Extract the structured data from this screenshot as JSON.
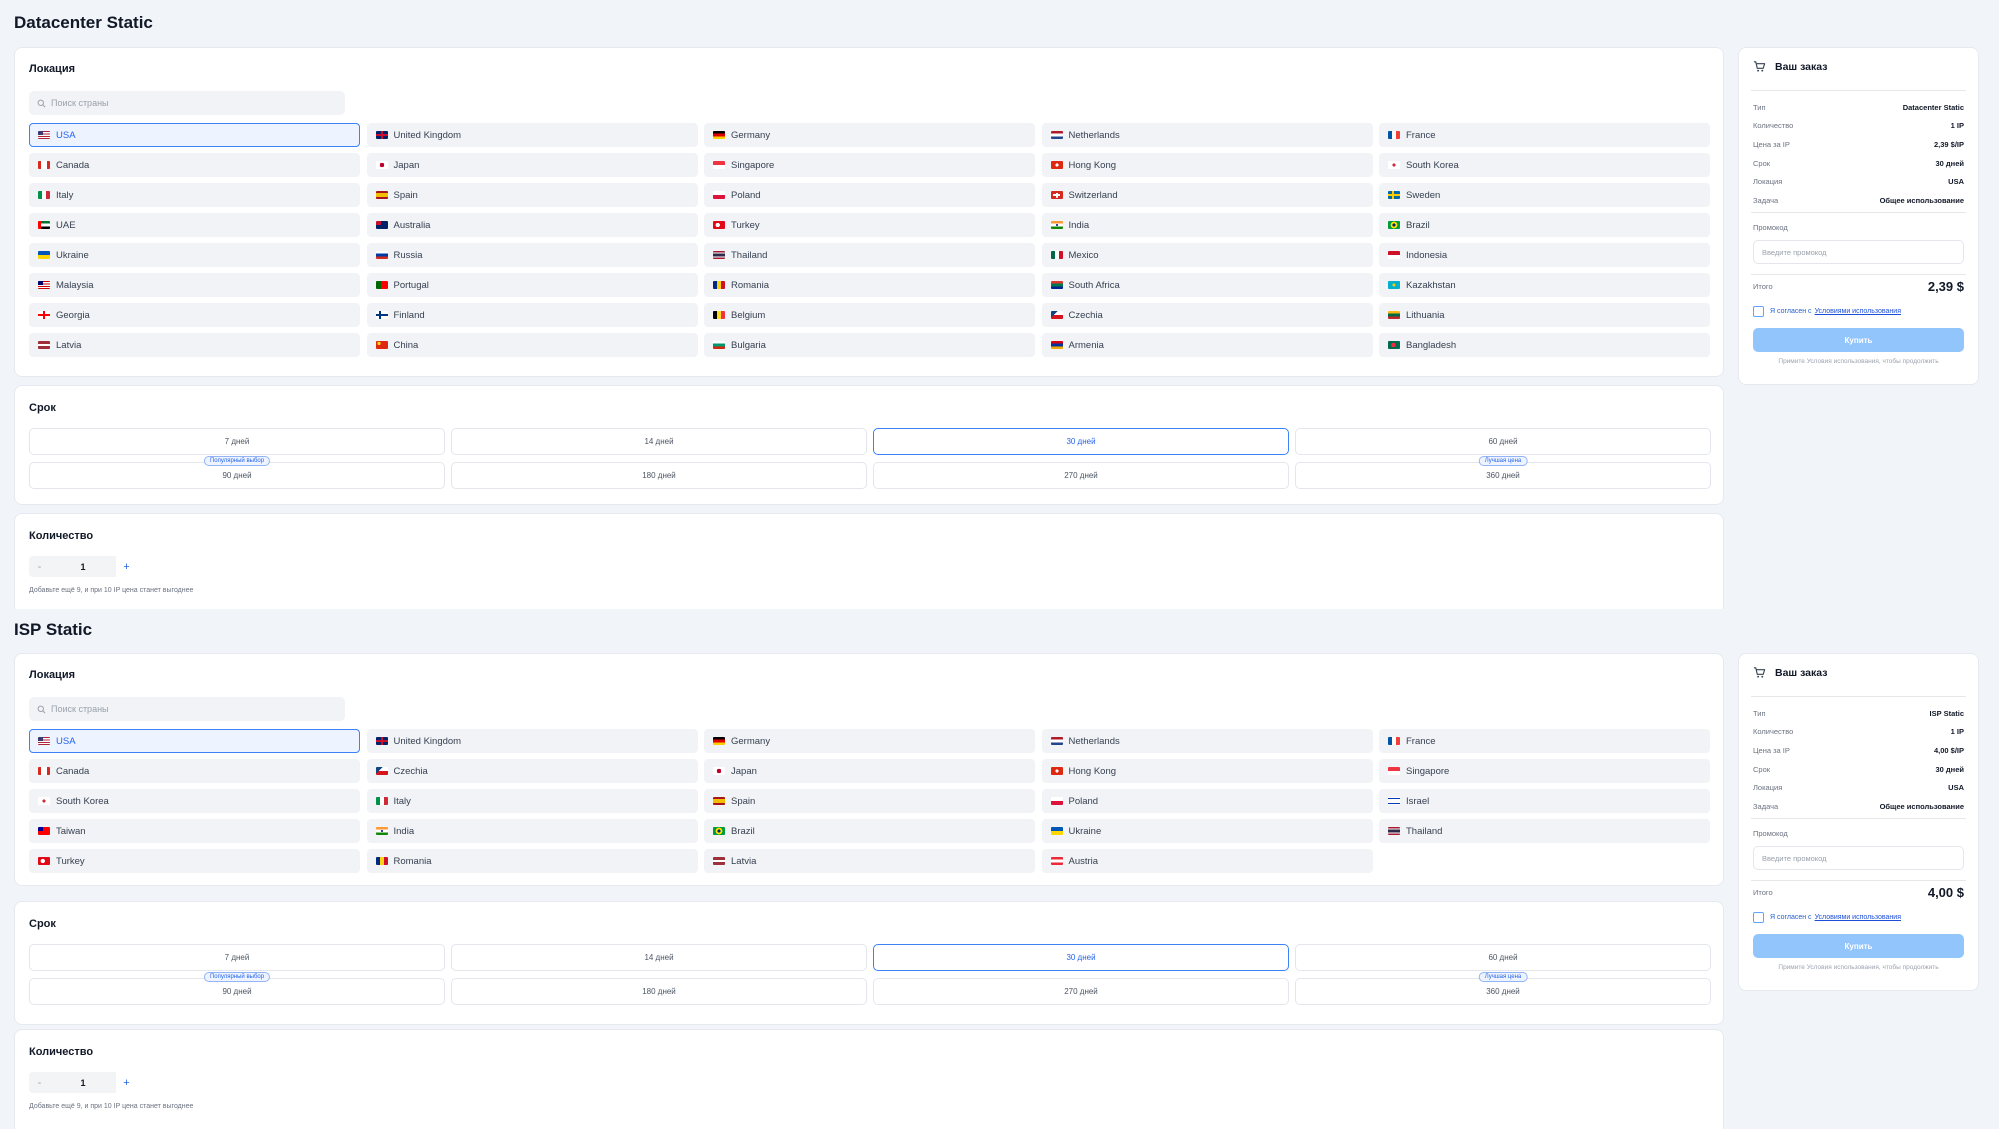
{
  "sections": [
    {
      "title": "Datacenter Static",
      "location_label": "Локация",
      "search_placeholder": "Поиск страны",
      "countries": [
        {
          "name": "USA",
          "flag": "us",
          "selected": true
        },
        {
          "name": "United Kingdom",
          "flag": "gb"
        },
        {
          "name": "Germany",
          "flag": "de"
        },
        {
          "name": "Netherlands",
          "flag": "nl"
        },
        {
          "name": "France",
          "flag": "fr"
        },
        {
          "name": "Canada",
          "flag": "ca"
        },
        {
          "name": "Japan",
          "flag": "jp"
        },
        {
          "name": "Singapore",
          "flag": "sg"
        },
        {
          "name": "Hong Kong",
          "flag": "hk"
        },
        {
          "name": "South Korea",
          "flag": "kr"
        },
        {
          "name": "Italy",
          "flag": "it"
        },
        {
          "name": "Spain",
          "flag": "es"
        },
        {
          "name": "Poland",
          "flag": "pl"
        },
        {
          "name": "Switzerland",
          "flag": "ch"
        },
        {
          "name": "Sweden",
          "flag": "se"
        },
        {
          "name": "UAE",
          "flag": "ae"
        },
        {
          "name": "Australia",
          "flag": "au"
        },
        {
          "name": "Turkey",
          "flag": "tr"
        },
        {
          "name": "India",
          "flag": "in"
        },
        {
          "name": "Brazil",
          "flag": "br"
        },
        {
          "name": "Ukraine",
          "flag": "ua"
        },
        {
          "name": "Russia",
          "flag": "ru"
        },
        {
          "name": "Thailand",
          "flag": "th"
        },
        {
          "name": "Mexico",
          "flag": "mx"
        },
        {
          "name": "Indonesia",
          "flag": "id"
        },
        {
          "name": "Malaysia",
          "flag": "my"
        },
        {
          "name": "Portugal",
          "flag": "pt"
        },
        {
          "name": "Romania",
          "flag": "ro"
        },
        {
          "name": "South Africa",
          "flag": "za"
        },
        {
          "name": "Kazakhstan",
          "flag": "kz"
        },
        {
          "name": "Georgia",
          "flag": "ge"
        },
        {
          "name": "Finland",
          "flag": "fi"
        },
        {
          "name": "Belgium",
          "flag": "be"
        },
        {
          "name": "Czechia",
          "flag": "cz"
        },
        {
          "name": "Lithuania",
          "flag": "lt"
        },
        {
          "name": "Latvia",
          "flag": "lv"
        },
        {
          "name": "China",
          "flag": "cn"
        },
        {
          "name": "Bulgaria",
          "flag": "bg"
        },
        {
          "name": "Armenia",
          "flag": "am"
        },
        {
          "name": "Bangladesh",
          "flag": "bd"
        }
      ],
      "term_label": "Срок",
      "terms": [
        {
          "label": "7 дней"
        },
        {
          "label": "14 дней"
        },
        {
          "label": "30 дней",
          "selected": true
        },
        {
          "label": "60 дней"
        },
        {
          "label": "90 дней",
          "badge": "Популярный выбор"
        },
        {
          "label": "180 дней"
        },
        {
          "label": "270 дней"
        },
        {
          "label": "360 дней",
          "badge": "Лучшая цена"
        }
      ],
      "quantity_label": "Количество",
      "quantity": {
        "minus": "-",
        "value": "1",
        "plus": "+",
        "hint": "Добавьте ещё 9, и при 10 IP цена станет выгоднее"
      },
      "order": {
        "title": "Ваш заказ",
        "rows": [
          {
            "key": "Тип",
            "value": "Datacenter Static"
          },
          {
            "key": "Количество",
            "value": "1 IP"
          },
          {
            "key": "Цена за IP",
            "value": "2,39 $/IP"
          },
          {
            "key": "Срок",
            "value": "30 дней"
          },
          {
            "key": "Локация",
            "value": "USA"
          },
          {
            "key": "Задача",
            "value": "Общее использование"
          }
        ],
        "promo_label": "Промокод",
        "promo_placeholder": "Введите промокод",
        "total_label": "Итого",
        "total_value": "2,39 $",
        "agree_text": "Я согласен с",
        "agree_link": "Условиями использования",
        "buy_label": "Купить",
        "buy_hint": "Примите Условия использования, чтобы продолжить"
      }
    },
    {
      "title": "ISP Static",
      "location_label": "Локация",
      "search_placeholder": "Поиск страны",
      "countries": [
        {
          "name": "USA",
          "flag": "us",
          "selected": true
        },
        {
          "name": "United Kingdom",
          "flag": "gb"
        },
        {
          "name": "Germany",
          "flag": "de"
        },
        {
          "name": "Netherlands",
          "flag": "nl"
        },
        {
          "name": "France",
          "flag": "fr"
        },
        {
          "name": "Canada",
          "flag": "ca"
        },
        {
          "name": "Czechia",
          "flag": "cz"
        },
        {
          "name": "Japan",
          "flag": "jp"
        },
        {
          "name": "Hong Kong",
          "flag": "hk"
        },
        {
          "name": "Singapore",
          "flag": "sg"
        },
        {
          "name": "South Korea",
          "flag": "kr"
        },
        {
          "name": "Italy",
          "flag": "it"
        },
        {
          "name": "Spain",
          "flag": "es"
        },
        {
          "name": "Poland",
          "flag": "pl"
        },
        {
          "name": "Israel",
          "flag": "il"
        },
        {
          "name": "Taiwan",
          "flag": "tw"
        },
        {
          "name": "India",
          "flag": "in"
        },
        {
          "name": "Brazil",
          "flag": "br"
        },
        {
          "name": "Ukraine",
          "flag": "ua"
        },
        {
          "name": "Thailand",
          "flag": "th"
        },
        {
          "name": "Turkey",
          "flag": "tr"
        },
        {
          "name": "Romania",
          "flag": "ro"
        },
        {
          "name": "Latvia",
          "flag": "lv"
        },
        {
          "name": "Austria",
          "flag": "at"
        }
      ],
      "term_label": "Срок",
      "terms": [
        {
          "label": "7 дней"
        },
        {
          "label": "14 дней"
        },
        {
          "label": "30 дней",
          "selected": true
        },
        {
          "label": "60 дней"
        },
        {
          "label": "90 дней",
          "badge": "Популярный выбор"
        },
        {
          "label": "180 дней"
        },
        {
          "label": "270 дней"
        },
        {
          "label": "360 дней",
          "badge": "Лучшая цена"
        }
      ],
      "quantity_label": "Количество",
      "quantity": {
        "minus": "-",
        "value": "1",
        "plus": "+",
        "hint": "Добавьте ещё 9, и при 10 IP цена станет выгоднее"
      },
      "order": {
        "title": "Ваш заказ",
        "rows": [
          {
            "key": "Тип",
            "value": "ISP Static"
          },
          {
            "key": "Количество",
            "value": "1 IP"
          },
          {
            "key": "Цена за IP",
            "value": "4,00 $/IP"
          },
          {
            "key": "Срок",
            "value": "30 дней"
          },
          {
            "key": "Локация",
            "value": "USA"
          },
          {
            "key": "Задача",
            "value": "Общее использование"
          }
        ],
        "promo_label": "Промокод",
        "promo_placeholder": "Введите промокод",
        "total_label": "Итого",
        "total_value": "4,00 $",
        "agree_text": "Я согласен с",
        "agree_link": "Условиями использования",
        "buy_label": "Купить",
        "buy_hint": "Примите Условия использования, чтобы продолжить"
      }
    }
  ]
}
